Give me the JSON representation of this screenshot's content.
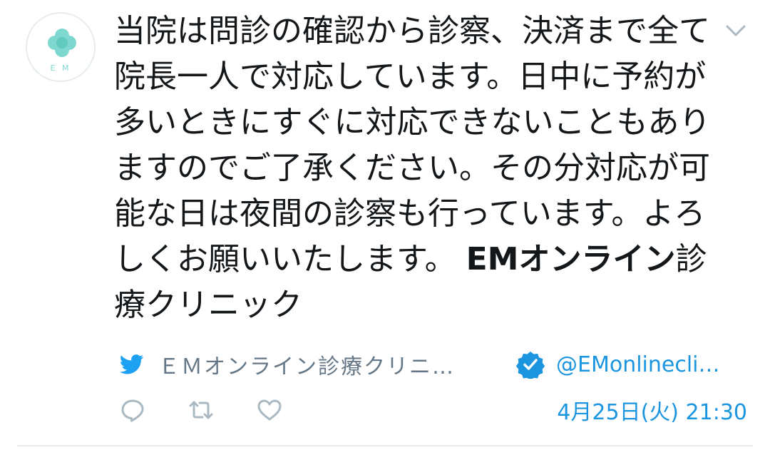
{
  "tweet": {
    "avatar_text": "E M",
    "body_text": "当院は問診の確認から診察、決済まで全て院長一人で対応しています。日中に予約が多いときにすぐに対応できないこともありますのでご了承ください。その分対応が可能な日は夜間の診察も行っています。よろしくお願いいたします。",
    "body_bold": "EMオンライン",
    "body_tail": "診療クリニック",
    "via_name": "ＥＭオンライン診療クリニ…",
    "handle": "@EMonlinecli…",
    "timestamp": "4月25日(火) 21:30"
  },
  "colors": {
    "accent": "#1b95e0",
    "text": "#14171a",
    "muted": "#657786",
    "avatar_mint": "#7fd8cf"
  },
  "icons": {
    "menu": "chevron-down-icon",
    "source": "twitter-bird-icon",
    "verified": "verified-badge-icon",
    "reply": "reply-icon",
    "retweet": "retweet-icon",
    "like": "heart-icon"
  }
}
